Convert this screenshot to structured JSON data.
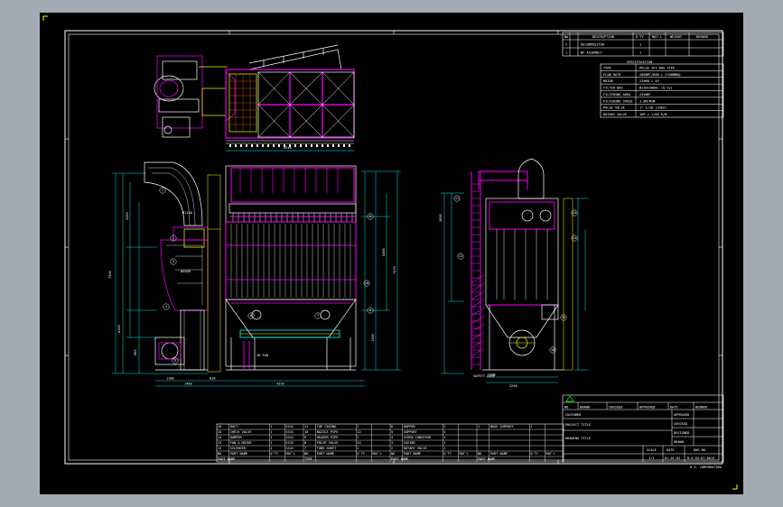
{
  "colors": {
    "background": "#000000",
    "frame": "#ffffff",
    "structure": "#ff00ff",
    "dimension": "#00ffff",
    "detail": "#ffffff",
    "accent": "#ffff00",
    "green": "#00ff00",
    "canvas_bg": "#a3aab2"
  },
  "revision_table": {
    "headers": [
      "NO",
      "DESCRIPTION",
      "Q'TY",
      "MAT'L",
      "WEIGHT",
      "REMARK"
    ],
    "rows": [
      [
        "2",
        "DECOMPOSITOR",
        "1",
        "",
        "",
        ""
      ],
      [
        "1",
        "BF ASSEMBLY",
        "1",
        "",
        "",
        ""
      ]
    ]
  },
  "specification": {
    "title": "SPECIFICATION",
    "rows": [
      [
        "TYPE",
        "PULSE JET BAG TYPE"
      ],
      [
        "FLOW RATE",
        "2000M³/MIN × 2700MMAQ"
      ],
      [
        "MOTOR",
        "220KW × 4P"
      ],
      [
        "FILTER BAG",
        "Ø150×3000L (Q'ty)"
      ],
      [
        "FILTERING AREA",
        "2350M²"
      ],
      [
        "FILTERING SPEED",
        "1.0M/MIN"
      ],
      [
        "PULSE VALVE",
        "1\" 1/2B (24EA)"
      ],
      [
        "ROTARY VALVE",
        "1HP × 1/60 R/M"
      ]
    ]
  },
  "dimensions": {
    "top_width": "6940",
    "overall_height": "7300",
    "side_height": "7470",
    "base_total": "4320",
    "base_left": "1180",
    "base_mid": "1460",
    "base_right": "810",
    "side_base": "2250",
    "side_base_part": "1100",
    "vert_a": "3000",
    "vert_b": "5400",
    "vert_c": "2360",
    "vert_d": "4100",
    "vert_e": "800",
    "vert_f": "1300",
    "fan_label": "ID FAN",
    "inlet_label": "Ø4500",
    "duct_label": "Ø1150",
    "ladder_label": "SAFETY CAGE"
  },
  "parts_list": {
    "columns": [
      "NO",
      "PART NAME",
      "Q'TY",
      "MAT'L",
      "NO",
      "PART NAME",
      "Q'TY",
      "MAT'L",
      "NO",
      "PART NAME",
      "Q'TY",
      "MAT'L",
      "NO",
      "PART NAME",
      "Q'TY",
      "MAT'L"
    ],
    "rows": [
      [
        "16",
        "DUCT",
        "1",
        "SS41",
        "11",
        "TOP CASING",
        "1",
        "",
        "6",
        "HOPPER",
        "2",
        "",
        "1",
        "BASE SUPPORT",
        "1",
        ""
      ],
      [
        "15",
        "CHECK VALVE",
        "1",
        "SS41",
        "10",
        "NOZZLE PIPE",
        "12",
        "",
        "5",
        "SUPPORT",
        "4",
        "",
        "",
        "",
        "",
        ""
      ],
      [
        "14",
        "DAMPER",
        "1",
        "SS41",
        "9",
        "HEADER PIPE",
        "2",
        "",
        "4",
        "SCREW CONVEYOR",
        "1",
        "",
        "",
        "",
        "",
        ""
      ],
      [
        "13",
        "FAN & MOTOR",
        "1",
        "SS41",
        "8",
        "PULSE VALVE",
        "24",
        "",
        "3",
        "CASING",
        "1",
        "",
        "",
        "",
        "",
        ""
      ],
      [
        "12",
        "SILENCER",
        "1",
        "SS41",
        "7",
        "TUBE SHEET",
        "1",
        "",
        "2",
        "ROTARY VALVE",
        "1",
        "",
        "",
        "",
        "",
        ""
      ]
    ],
    "footer": [
      "PART NAME",
      "",
      "",
      "",
      "TYPE",
      "",
      "",
      "",
      "PART NAME",
      "",
      "",
      "",
      "PART NAME",
      "",
      "",
      ""
    ]
  },
  "title_block": {
    "header": [
      "NO",
      "DRAWN",
      "CHECKED",
      "APPROVED",
      "DATE",
      "REMARK"
    ],
    "fields": [
      {
        "label": "CUSTOMER",
        "value": ""
      },
      {
        "label": "PROJECT TITLE",
        "value": ""
      },
      {
        "label": "DRAWING TITLE",
        "value": ""
      }
    ],
    "signoff": [
      "APPROVED",
      "CHECKED",
      "DESIGNED",
      "DRAWN"
    ],
    "scale_row": [
      "SCALE",
      "DATE",
      "DWG NO"
    ],
    "scale_values": [
      "1:1",
      "01.01.01",
      "B-D-03-07-0013"
    ],
    "company": "H.I. CORPORATION"
  },
  "callouts": [
    "1",
    "2",
    "3",
    "4",
    "5",
    "6",
    "7",
    "8",
    "9",
    "10",
    "11",
    "12",
    "13",
    "14",
    "15",
    "16"
  ]
}
